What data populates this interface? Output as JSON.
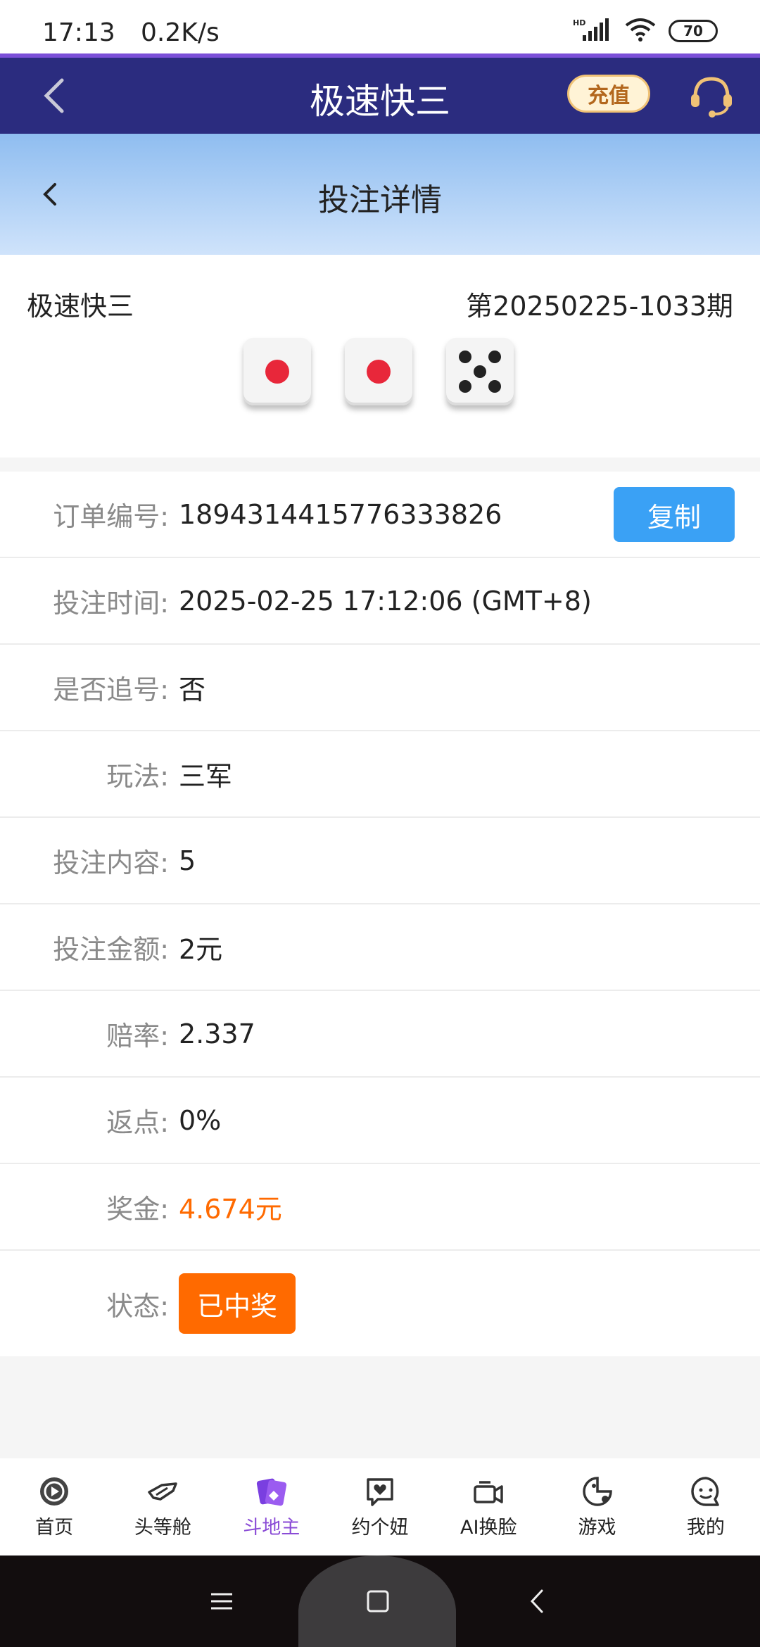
{
  "status_bar": {
    "time": "17:13",
    "speed": "0.2K/s",
    "signal_label": "HD",
    "battery": "70"
  },
  "app_header": {
    "title": "极速快三",
    "recharge_label": "充值",
    "back_icon": "chevron-left-icon",
    "support_icon": "headset-icon"
  },
  "sub_header": {
    "title": "投注详情",
    "back_icon": "chevron-left-icon"
  },
  "game": {
    "name": "极速快三",
    "period": "第20250225-1033期",
    "dice": [
      1,
      1,
      5
    ]
  },
  "details": {
    "order_no": {
      "label": "订单编号:",
      "value": "1894314415776333826"
    },
    "copy_label": "复制",
    "bet_time": {
      "label": "投注时间:",
      "value": "2025-02-25 17:12:06 (GMT+8)"
    },
    "chase": {
      "label": "是否追号:",
      "value": "否"
    },
    "play": {
      "label": "玩法:",
      "value": "三军"
    },
    "content": {
      "label": "投注内容:",
      "value": "5"
    },
    "amount": {
      "label": "投注金额:",
      "value": "2元"
    },
    "odds": {
      "label": "赔率:",
      "value": "2.337"
    },
    "rebate": {
      "label": "返点:",
      "value": "0%"
    },
    "prize": {
      "label": "奖金:",
      "value": "4.674元"
    },
    "status": {
      "label": "状态:",
      "value": "已中奖"
    }
  },
  "bottom_nav": {
    "items": [
      {
        "label": "首页",
        "icon": "play-circle-icon"
      },
      {
        "label": "头等舱",
        "icon": "plane-icon"
      },
      {
        "label": "斗地主",
        "icon": "cards-icon"
      },
      {
        "label": "约个妞",
        "icon": "heart-chat-icon"
      },
      {
        "label": "AI换脸",
        "icon": "camera-icon"
      },
      {
        "label": "游戏",
        "icon": "pacman-icon"
      },
      {
        "label": "我的",
        "icon": "smile-chat-icon"
      }
    ],
    "active_index": 2
  },
  "colors": {
    "header_bg": "#2b2c7f",
    "accent_blue": "#3aa1f5",
    "prize_orange": "#ff6a00",
    "nav_active": "#8a4bd6"
  }
}
